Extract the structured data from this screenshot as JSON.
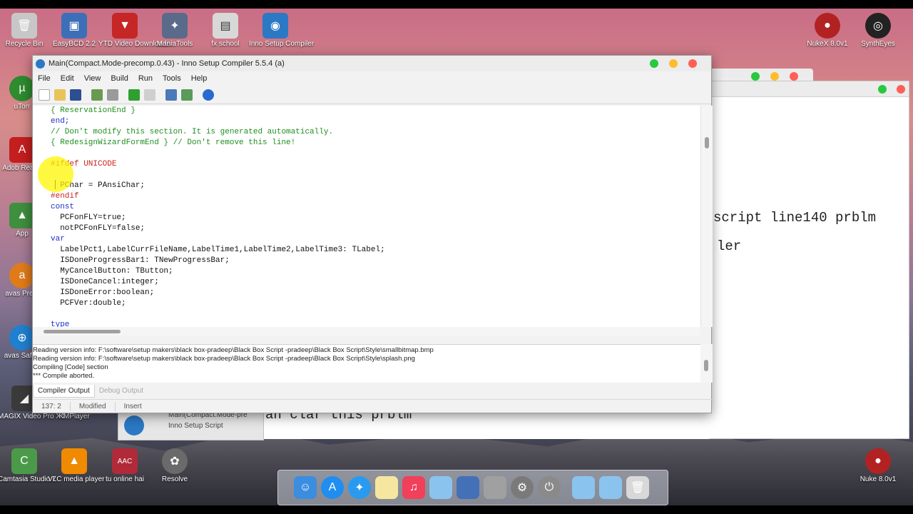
{
  "window": {
    "title": "Main(Compact.Mode-precomp.0.43) - Inno Setup Compiler 5.5.4 (a)"
  },
  "menu": [
    "File",
    "Edit",
    "View",
    "Build",
    "Run",
    "Tools",
    "Help"
  ],
  "code_lines": [
    {
      "text": "{ ReservationEnd }",
      "color": "#1f8f1f"
    },
    {
      "text": "end;",
      "color": "#1c2fc8"
    },
    {
      "text": "// Don't modify this section. It is generated automatically.",
      "color": "#1f8f1f"
    },
    {
      "text": "{ RedesignWizardFormEnd } // Don't remove this line!",
      "color": "#1f8f1f"
    },
    {
      "text": "",
      "color": "#000"
    },
    {
      "text": "#ifdef UNICODE",
      "color": "#c8261e"
    },
    {
      "text": "",
      "color": "#000"
    },
    {
      "text": "  PChar = PAnsiChar;",
      "color": "#111"
    },
    {
      "text": "#endif",
      "color": "#c8261e"
    },
    {
      "text": "const",
      "color": "#1c2fc8"
    },
    {
      "text": "  PCFonFLY=true;",
      "color": "#111"
    },
    {
      "text": "  notPCFonFLY=false;",
      "color": "#111"
    },
    {
      "text": "var",
      "color": "#1c2fc8"
    },
    {
      "text": "  LabelPct1,LabelCurrFileName,LabelTime1,LabelTime2,LabelTime3: TLabel;",
      "color": "#111"
    },
    {
      "text": "  ISDoneProgressBar1: TNewProgressBar;",
      "color": "#111"
    },
    {
      "text": "  MyCancelButton: TButton;",
      "color": "#111"
    },
    {
      "text": "  ISDoneCancel:integer;",
      "color": "#111"
    },
    {
      "text": "  ISDoneError:boolean;",
      "color": "#111"
    },
    {
      "text": "  PCFVer:double;",
      "color": "#111"
    },
    {
      "text": "",
      "color": "#000"
    },
    {
      "text": "type",
      "color": "#1c2fc8"
    }
  ],
  "output": {
    "lines": [
      "   Reading version info: F:\\software\\setup makers\\black box-pradeep\\Black Box Script -pradeep\\Black Box Script\\Style\\smallbitmap.bmp",
      "   Reading version info: F:\\software\\setup makers\\black box-pradeep\\Black Box Script -pradeep\\Black Box Script\\Style\\splash.png",
      "Compiling [Code] section",
      "*** Compile aborted."
    ],
    "tab_active": "Compiler Output",
    "tab_inactive": "Debug Output"
  },
  "status": {
    "position": "137:  2",
    "modified": "Modified",
    "mode": "Insert"
  },
  "background": {
    "line1": "script line140 prblm",
    "line2": "ler",
    "line3": "an clar this prblm",
    "thumb_title": "Main(Compact.Mode-pre",
    "thumb_sub": "Inno Setup Script"
  },
  "desktop_icons": [
    {
      "label": "Recycle Bin",
      "color": "#c7c7c7",
      "glyph": "🗑"
    },
    {
      "label": "EasyBCD 2.2",
      "color": "#3c6fb8",
      "glyph": "▣"
    },
    {
      "label": "YTD Video Downloader",
      "color": "#c62626",
      "glyph": "▼"
    },
    {
      "label": "ManiaTools",
      "color": "#5a6a8a",
      "glyph": "✦"
    },
    {
      "label": "fx school",
      "color": "#d8d8d8",
      "glyph": "▤"
    },
    {
      "label": "Inno Setup Compiler",
      "color": "#2b78c5",
      "glyph": "◉"
    },
    {
      "label": "NukeX 8.0v1",
      "color": "#b22222",
      "glyph": "●"
    },
    {
      "label": "SynthEyes",
      "color": "#222222",
      "glyph": "◎"
    },
    {
      "label": "uTorr",
      "color": "#2e8b2e",
      "glyph": "µ"
    },
    {
      "label": "Adob Reade",
      "color": "#c51e1e",
      "glyph": "A"
    },
    {
      "label": "App",
      "color": "#3f8f3f",
      "glyph": "▲"
    },
    {
      "label": "avas Prem",
      "color": "#e07b1a",
      "glyph": "a"
    },
    {
      "label": "avas SafeZ",
      "color": "#2080d0",
      "glyph": "⊕"
    },
    {
      "label": "MAGIX Video Pro X4",
      "color": "#3a3a3a",
      "glyph": "◢"
    },
    {
      "label": "KMPlayer",
      "color": "#444444",
      "glyph": "K"
    },
    {
      "label": "Camtasia Studio 7",
      "color": "#4a9a4a",
      "glyph": "C"
    },
    {
      "label": "VLC media player",
      "color": "#f08a00",
      "glyph": "▲"
    },
    {
      "label": "tu online hai",
      "color": "#b02a3a",
      "glyph": "AAC"
    },
    {
      "label": "Resolve",
      "color": "#6a6a6a",
      "glyph": "✿"
    },
    {
      "label": "Nuke 8.0v1",
      "color": "#b22222",
      "glyph": "●"
    }
  ]
}
